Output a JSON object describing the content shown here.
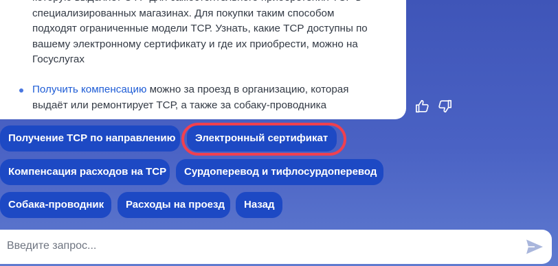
{
  "message": {
    "paragraph_lines": [
      "которую выделяет СФР для самостоятельного приобретения ТСР в",
      "специализированных магазинах. Для покупки таким способом",
      "подходят ограниченные модели ТСР. Узнать, какие ТСР доступны по",
      "вашему электронному сертификату и где их приобрести, можно на",
      "Госуслугах"
    ],
    "bullet_link": "Получить компенсацию",
    "bullet_line1": " можно за проезд в организацию, которая",
    "bullet_line2": "выдаёт или ремонтирует ТСР, а также за собаку-проводника"
  },
  "feedback": {
    "like_icon": "thumbs-up-icon",
    "dislike_icon": "thumbs-down-icon"
  },
  "chips": [
    "Получение ТСР по направлению",
    "Электронный сертификат",
    "Компенсация расходов на ТСР",
    "Сурдоперевод и тифлосурдоперевод",
    "Собака-проводник",
    "Расходы на проезд",
    "Назад"
  ],
  "highlighted_chip": "Электронный сертификат",
  "input": {
    "placeholder": "Введите запрос...",
    "send_icon": "send-icon"
  },
  "colors": {
    "chip_background": "#1d49c4",
    "link": "#1f5dd6",
    "highlight_ring": "#f0404f"
  }
}
